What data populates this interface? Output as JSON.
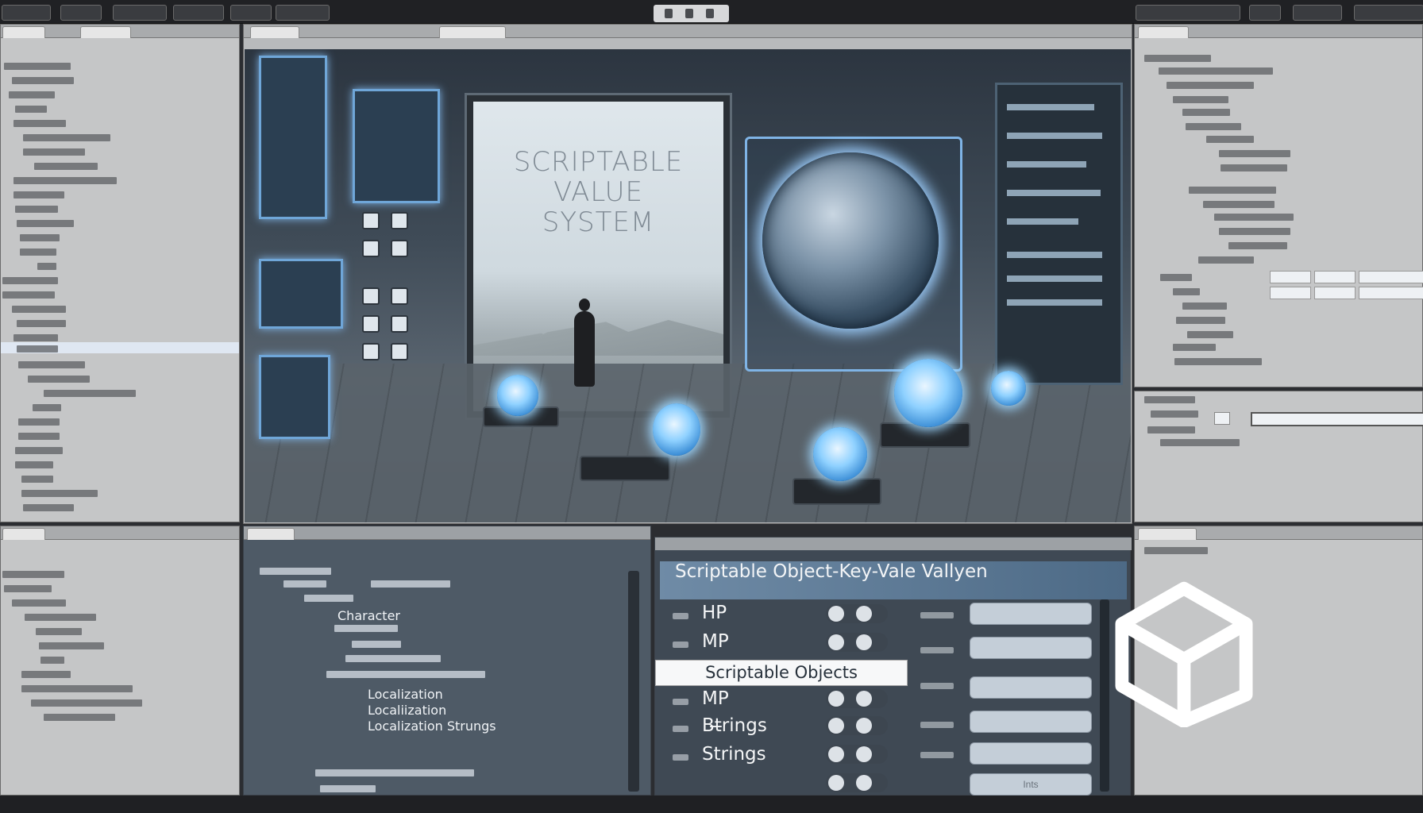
{
  "scene": {
    "title_lines": [
      "SCRIPTABLE",
      "VALUE",
      "SYSTEM"
    ]
  },
  "inspector": {
    "title": "Scriptable Object-Key-Vale Vallyen",
    "rows": [
      {
        "label": "HP"
      },
      {
        "label": "MP"
      },
      {
        "label": "Scriptable Objects",
        "selected": true
      },
      {
        "label": "MP"
      },
      {
        "label": "Bt̶rings"
      },
      {
        "label": "Strings"
      },
      {
        "label": ""
      }
    ],
    "last_field_value": "Ints"
  },
  "project_tree": {
    "items": [
      "Character",
      "Localization",
      "Localiization",
      "Localization Strungs"
    ]
  },
  "colors": {
    "accent": "#7fb4e6",
    "panel_bg": "#c5c6c7",
    "panel_dark": "#4e5a66",
    "selection": "#dfe7f2",
    "toolbar": "#202124"
  },
  "icons": [
    "unity-logo-icon",
    "play-icon",
    "pause-icon",
    "step-icon",
    "radio-dot-icon"
  ]
}
